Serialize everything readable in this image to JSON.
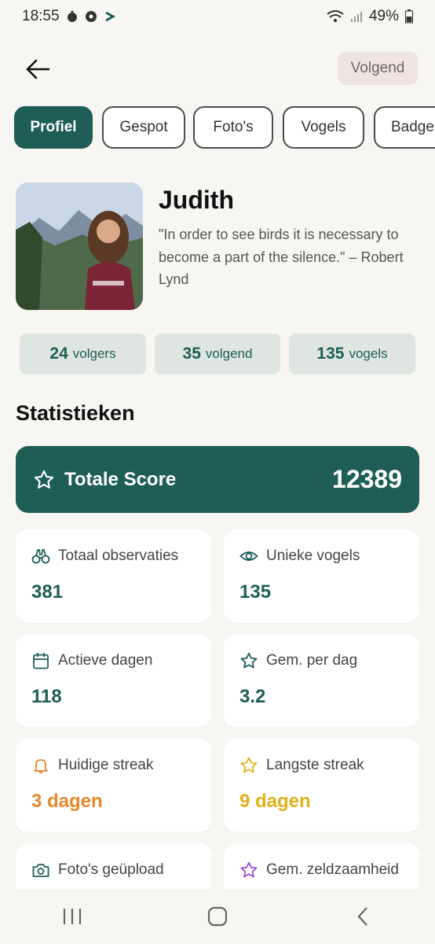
{
  "status_bar": {
    "time": "18:55",
    "battery": "49%"
  },
  "header": {
    "follow_label": "Volgend"
  },
  "tabs": [
    {
      "label": "Profiel",
      "active": true
    },
    {
      "label": "Gespot",
      "active": false
    },
    {
      "label": "Foto's",
      "active": false
    },
    {
      "label": "Vogels",
      "active": false
    },
    {
      "label": "Badges",
      "active": false
    }
  ],
  "profile": {
    "name": "Judith",
    "quote": "\"In order to see birds it is necessary to become a part of the silence.\" – Robert Lynd"
  },
  "counts": [
    {
      "value": "24",
      "label": "volgers"
    },
    {
      "value": "35",
      "label": "volgend"
    },
    {
      "value": "135",
      "label": "vogels"
    }
  ],
  "statistics": {
    "title": "Statistieken",
    "total_score": {
      "label": "Totale Score",
      "value": "12389"
    },
    "cards": [
      {
        "icon": "binoculars-icon",
        "label": "Totaal observaties",
        "value": "381",
        "color": "#1e5e57"
      },
      {
        "icon": "eye-icon",
        "label": "Unieke vogels",
        "value": "135",
        "color": "#1e5e57"
      },
      {
        "icon": "calendar-icon",
        "label": "Actieve dagen",
        "value": "118",
        "color": "#1e5e57"
      },
      {
        "icon": "star-icon",
        "label": "Gem. per dag",
        "value": "3.2",
        "color": "#1e5e57"
      },
      {
        "icon": "bell-icon",
        "label": "Huidige streak",
        "value": "3 dagen",
        "color": "#e8882a"
      },
      {
        "icon": "star-icon",
        "label": "Langste streak",
        "value": "9 dagen",
        "color": "#e0b21a"
      },
      {
        "icon": "camera-icon",
        "label": "Foto's geüpload",
        "value": "",
        "color": "#1e5e57"
      },
      {
        "icon": "star-icon",
        "label": "Gem. zeldzaamheid",
        "value": "",
        "color": "#9b4fd0"
      }
    ]
  },
  "colors": {
    "primary": "#1e5e57",
    "background": "#f7f6f3",
    "chip": "#dfe5e1",
    "follow_button": "#f0e4e0"
  }
}
